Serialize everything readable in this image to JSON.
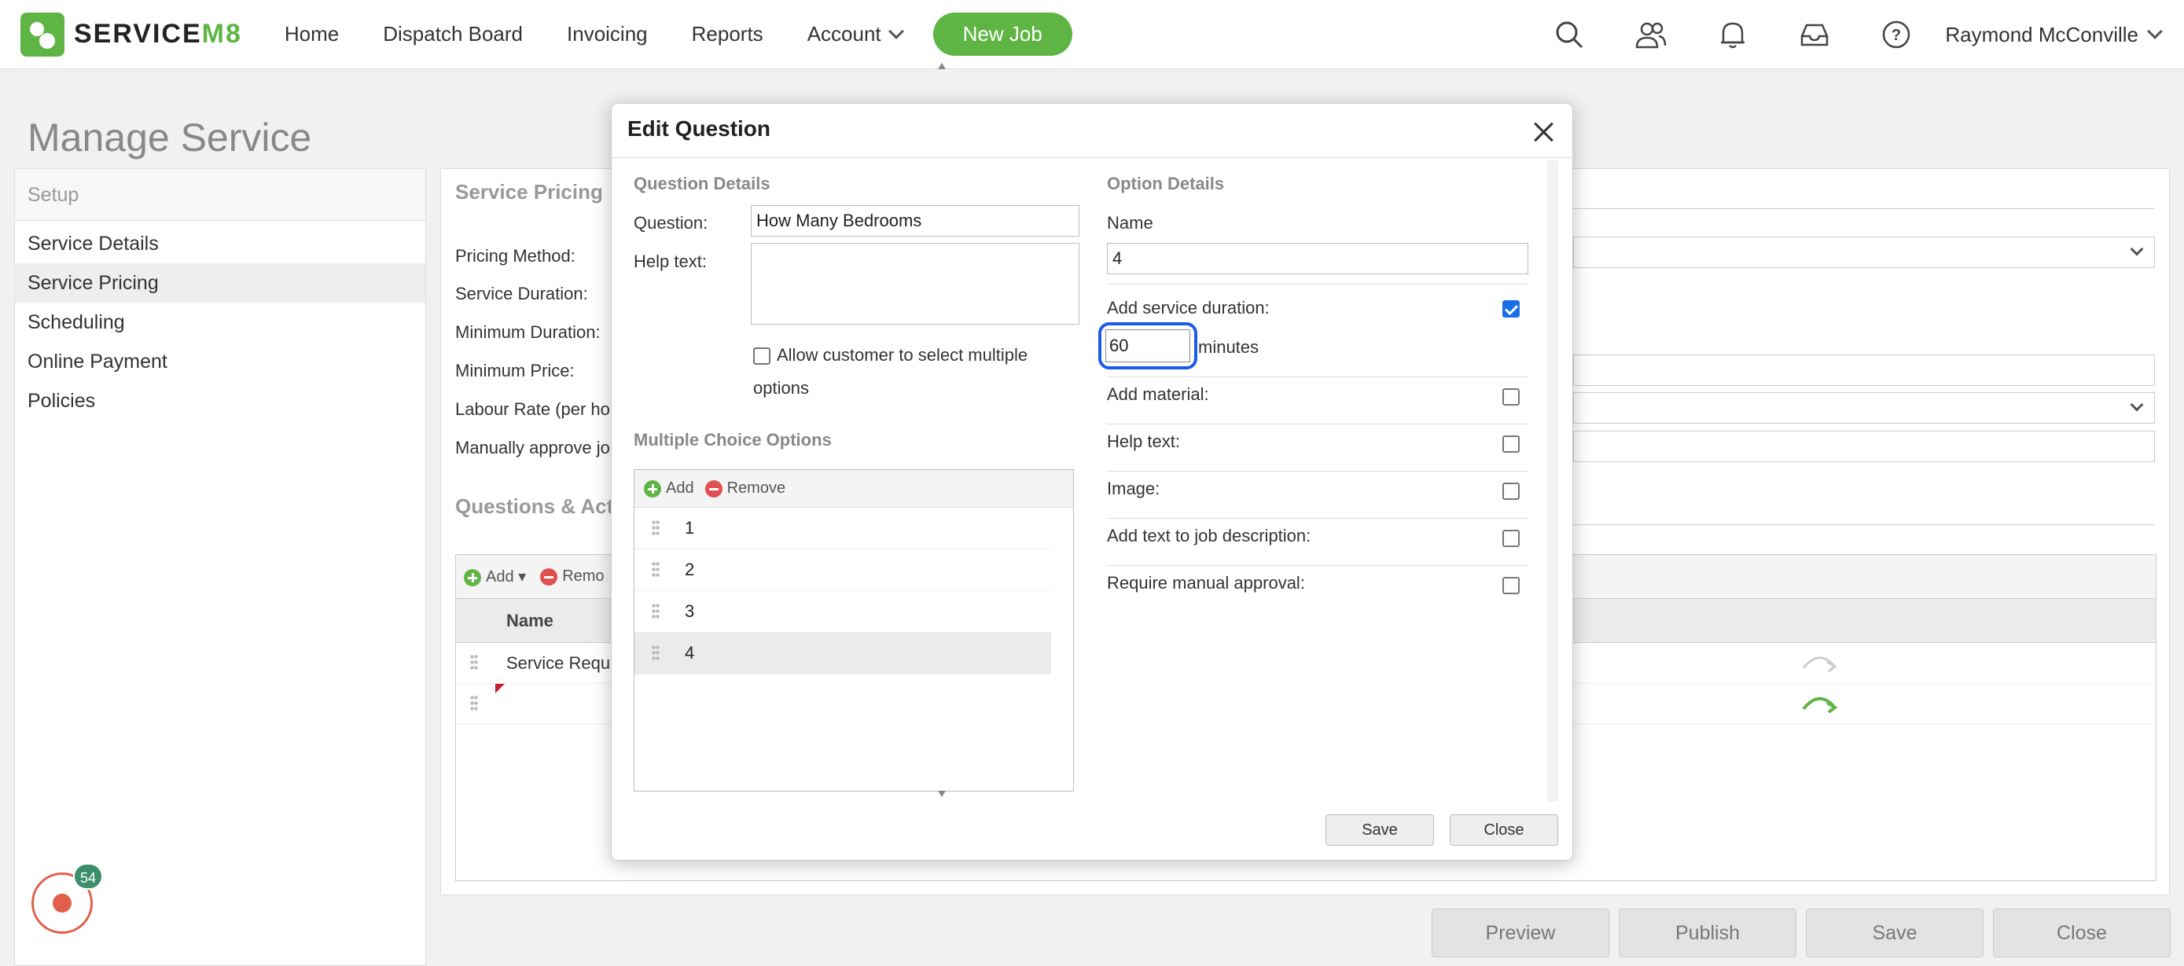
{
  "nav": {
    "brand_service": "SERVICE",
    "brand_m8": "M8",
    "items": [
      "Home",
      "Dispatch Board",
      "Invoicing",
      "Reports",
      "Account"
    ],
    "new_job": "New Job",
    "user": "Raymond McConville"
  },
  "page": {
    "title": "Manage Service"
  },
  "sidebar": {
    "header": "Setup",
    "items": [
      "Service Details",
      "Service Pricing",
      "Scheduling",
      "Online Payment",
      "Policies"
    ]
  },
  "pricing": {
    "title": "Service Pricing",
    "labels": [
      "Pricing Method:",
      "Service Duration:",
      "Minimum Duration:",
      "Minimum Price:",
      "Labour Rate (per hou",
      "Manually approve jo"
    ]
  },
  "qa": {
    "title": "Questions & Acti",
    "add": "Add",
    "remove": "Remo",
    "col_name": "Name",
    "rows": [
      "Service Requi",
      ""
    ]
  },
  "record_badge": "54",
  "bottom": {
    "preview": "Preview",
    "publish": "Publish",
    "save": "Save",
    "close": "Close"
  },
  "modal": {
    "title": "Edit Question",
    "question_details": "Question Details",
    "question_label": "Question:",
    "question_value": "How Many Bedrooms",
    "help_label": "Help text:",
    "allow_multi": "Allow customer to select multiple",
    "allow_multi_2": "options",
    "mco_title": "Multiple Choice Options",
    "mco_add": "Add",
    "mco_remove": "Remove",
    "options": [
      "1",
      "2",
      "3",
      "4"
    ],
    "option_details": "Option Details",
    "name_label": "Name",
    "name_value": "4",
    "add_duration": "Add service duration:",
    "duration_value": "60",
    "minutes": "minutes",
    "add_material": "Add material:",
    "help_text": "Help text:",
    "image": "Image:",
    "add_text_desc": "Add text to job description:",
    "require_approval": "Require manual approval:",
    "save": "Save",
    "close": "Close"
  }
}
